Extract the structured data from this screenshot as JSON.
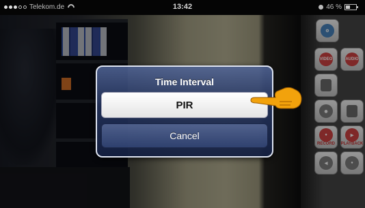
{
  "status_bar": {
    "carrier": "Telekom.de",
    "time": "13:42",
    "battery": "46 %",
    "battery_level": 0.46,
    "icons": [
      "signal-dots-icon",
      "wifi-icon",
      "lock-rotation-icon",
      "battery-icon"
    ]
  },
  "dialog": {
    "title": "Time Interval",
    "options": [
      {
        "label": "PIR"
      }
    ],
    "cancel_label": "Cancel"
  },
  "side_panel": {
    "buttons": [
      {
        "name": "settings-gear-button",
        "icon": "gear-icon",
        "label": ""
      },
      {
        "name": "video-button",
        "icon": "video-icon",
        "label": "VIDEO"
      },
      {
        "name": "audio-button",
        "icon": "audio-icon",
        "label": "AUDIO"
      },
      {
        "name": "phone-button",
        "icon": "phone-icon",
        "label": ""
      },
      {
        "name": "camera-snapshot-button",
        "icon": "camera-icon",
        "label": ""
      },
      {
        "name": "gallery-button",
        "icon": "photos-icon",
        "label": ""
      },
      {
        "name": "record-button",
        "icon": "record-icon",
        "label": "RECORD"
      },
      {
        "name": "playback-button",
        "icon": "playback-icon",
        "label": "PLAYBACK"
      },
      {
        "name": "speaker-button",
        "icon": "speaker-icon",
        "label": ""
      },
      {
        "name": "microphone-button",
        "icon": "microphone-icon",
        "label": ""
      }
    ]
  },
  "colors": {
    "dialog_top": "#50649a",
    "dialog_bottom": "#142042",
    "pointer_hand": "#f2a20c"
  }
}
